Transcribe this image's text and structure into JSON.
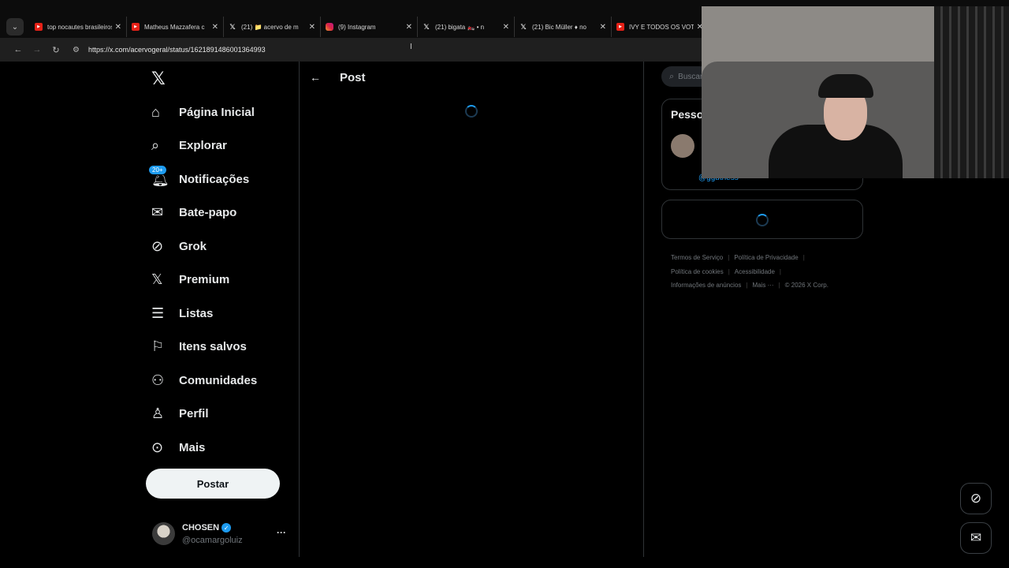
{
  "browser": {
    "tabs": [
      {
        "favicon": "youtube-icon",
        "title": "top nocautes brasileiros"
      },
      {
        "favicon": "youtube-icon",
        "title": "Matheus Mazzafera c"
      },
      {
        "favicon": "x-icon",
        "title": "(21) 📁 acervo de m"
      },
      {
        "favicon": "instagram-icon",
        "title": "(9) Instagram"
      },
      {
        "favicon": "x-icon",
        "title": "(21) bigata 🏍️ • n"
      },
      {
        "favicon": "x-icon",
        "title": "(21) Bic Müller ♦ no"
      },
      {
        "favicon": "youtube-icon",
        "title": "IVY E TODOS OS VOT"
      }
    ],
    "url": "https://x.com/acervogeral/status/1621891486001364993"
  },
  "sidebar": {
    "logo": "𝕏",
    "items": [
      {
        "icon": "home-icon",
        "glyph": "⌂",
        "label": "Página Inicial"
      },
      {
        "icon": "search-icon",
        "glyph": "⌕",
        "label": "Explorar"
      },
      {
        "icon": "bell-icon",
        "glyph": "🔔︎",
        "label": "Notificações",
        "badge": "20+"
      },
      {
        "icon": "mail-icon",
        "glyph": "✉",
        "label": "Bate-papo"
      },
      {
        "icon": "grok-icon",
        "glyph": "⊘",
        "label": "Grok"
      },
      {
        "icon": "x-premium-icon",
        "glyph": "𝕏",
        "label": "Premium"
      },
      {
        "icon": "list-icon",
        "glyph": "☰",
        "label": "Listas"
      },
      {
        "icon": "bookmark-icon",
        "glyph": "⚐",
        "label": "Itens salvos"
      },
      {
        "icon": "communities-icon",
        "glyph": "⚇",
        "label": "Comunidades"
      },
      {
        "icon": "profile-icon",
        "glyph": "♙",
        "label": "Perfil"
      },
      {
        "icon": "more-icon",
        "glyph": "⊙",
        "label": "Mais"
      }
    ],
    "post_button": "Postar",
    "profile": {
      "name": "CHOSEN",
      "handle": "@ocamargoluiz",
      "more": "···"
    }
  },
  "main": {
    "back_glyph": "←",
    "title": "Post"
  },
  "right": {
    "search_placeholder": "Buscar",
    "who_to_follow_title": "Pesso",
    "who_handle": "@ggutness",
    "footer": [
      "Termos de Serviço",
      "Política de Privacidade",
      "Política de cookies",
      "Acessibilidade",
      "Informações de anúncios",
      "Mais ···",
      "© 2026 X Corp."
    ]
  },
  "fabs": {
    "grok_glyph": "⊘",
    "messages_glyph": "✉"
  },
  "colors": {
    "accent": "#1d9bf0",
    "background": "#000000",
    "border": "#2f3336",
    "muted": "#71767b"
  }
}
